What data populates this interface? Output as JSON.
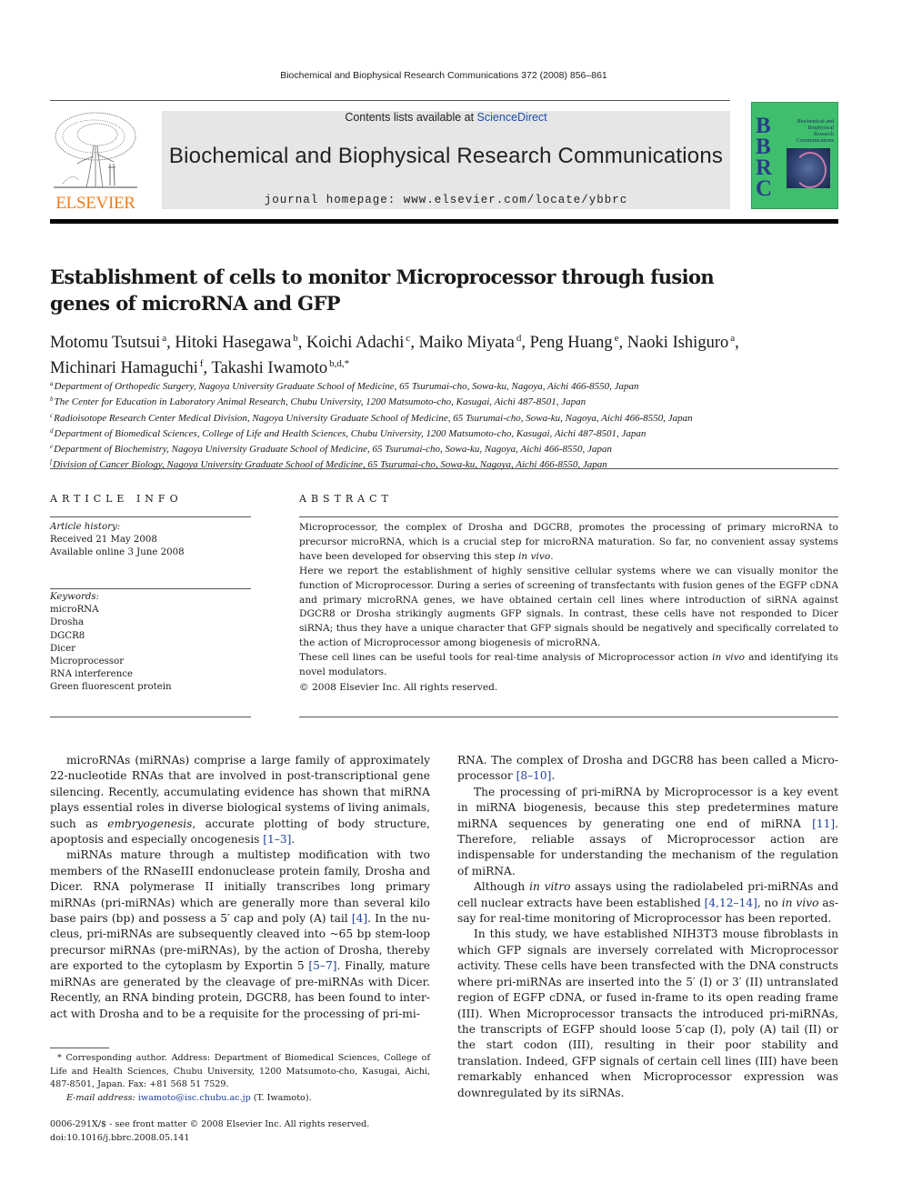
{
  "running_head": "Biochemical and Biophysical Research Communications 372 (2008) 856–861",
  "banner": {
    "contents_prefix": "Contents lists available at ",
    "contents_link": "ScienceDirect",
    "journal_title": "Biochemical and Biophysical Research Communications",
    "homepage": "journal homepage: www.elsevier.com/locate/ybbrc"
  },
  "logo": {
    "publisher": "ELSEVIER"
  },
  "cover": {
    "letters": [
      "B",
      "B",
      "R",
      "C"
    ],
    "title_lines": [
      "Biochemical and",
      "Biophysical",
      "Research",
      "Communications"
    ],
    "colors": {
      "background": "#3fbf6e",
      "letters": "#2b3a8c"
    }
  },
  "article": {
    "title": "Establishment of cells to monitor Microprocessor through fusion genes of microRNA and GFP",
    "authors": [
      {
        "name": "Motomu Tsutsui",
        "sup": "a"
      },
      {
        "name": "Hitoki Hasegawa",
        "sup": "b"
      },
      {
        "name": "Koichi Adachi",
        "sup": "c"
      },
      {
        "name": "Maiko Miyata",
        "sup": "d"
      },
      {
        "name": "Peng Huang",
        "sup": "e"
      },
      {
        "name": "Naoki Ishiguro",
        "sup": "a"
      },
      {
        "name": "Michinari Hamaguchi",
        "sup": "f"
      },
      {
        "name": "Takashi Iwamoto",
        "sup": "b,d,*"
      }
    ],
    "affiliations": [
      {
        "sup": "a",
        "text": "Department of Orthopedic Surgery, Nagoya University Graduate School of Medicine, 65 Tsurumai-cho, Sowa-ku, Nagoya, Aichi 466-8550, Japan"
      },
      {
        "sup": "b",
        "text": "The Center for Education in Laboratory Animal Research, Chubu University, 1200 Matsumoto-cho, Kasugai, Aichi 487-8501, Japan"
      },
      {
        "sup": "c",
        "text": "Radioisotope Research Center Medical Division, Nagoya University Graduate School of Medicine, 65 Tsurumai-cho, Sowa-ku, Nagoya, Aichi 466-8550, Japan"
      },
      {
        "sup": "d",
        "text": "Department of Biomedical Sciences, College of Life and Health Sciences, Chubu University, 1200 Matsumoto-cho, Kasugai, Aichi 487-8501, Japan"
      },
      {
        "sup": "e",
        "text": "Department of Biochemistry, Nagoya University Graduate School of Medicine, 65 Tsurumai-cho, Sowa-ku, Nagoya, Aichi 466-8550, Japan"
      },
      {
        "sup": "f",
        "text": "Division of Cancer Biology, Nagoya University Graduate School of Medicine, 65 Tsurumai-cho, Sowa-ku, Nagoya, Aichi 466-8550, Japan"
      }
    ]
  },
  "article_info": {
    "heading": "ARTICLE INFO",
    "history_label": "Article history:",
    "received": "Received 21 May 2008",
    "available": "Available online 3 June 2008",
    "keywords_label": "Keywords:",
    "keywords": [
      "microRNA",
      "Drosha",
      "DGCR8",
      "Dicer",
      "Microprocessor",
      "RNA interference",
      "Green fluorescent protein"
    ]
  },
  "abstract": {
    "heading": "ABSTRACT",
    "p1a": "Microprocessor, the complex of Drosha and DGCR8, promotes the processing of primary microRNA to precursor microRNA, which is a crucial step for microRNA maturation. So far, no convenient assay systems have been developed for observing this step ",
    "p1_it": "in vivo",
    "p1b": ".",
    "p2": "Here we report the establishment of highly sensitive cellular systems where we can visually monitor the function of Microprocessor. During a series of screening of transfectants with fusion genes of the EGFP cDNA and primary microRNA genes, we have obtained certain cell lines where introduction of siRNA against DGCR8 or Drosha strikingly augments GFP signals. In contrast, these cells have not responded to Dicer siRNA; thus they have a unique character that GFP signals should be negatively and specifically correlated to the action of Microprocessor among biogenesis of microRNA.",
    "p3a": "These cell lines can be useful tools for real-time analysis of Microprocessor action ",
    "p3_it": "in vivo",
    "p3b": " and identifying its novel modulators.",
    "copyright": "© 2008 Elsevier Inc. All rights reserved."
  },
  "body": {
    "col1": {
      "p1a": "microRNAs (miRNAs) comprise a large family of approximately 22-nucleotide RNAs that are involved in post-transcriptional gene silencing. Recently, accumulating evidence has shown that miRNA plays essential roles in diverse biological systems of living animals, such as ",
      "p1_it": "embryogenesis",
      "p1b": ", accurate plotting of body structure, apopto­sis and especially oncogenesis ",
      "p1_ref": "[1–3]",
      "p1c": ".",
      "p2a": "miRNAs mature through a multistep modification with two members of the RNaseIII endonuclease protein family, Drosha and Dicer. RNA polymerase II initially transcribes long primary miRNAs (pri-miRNAs) which are generally more than several kilo base pairs (bp) and possess a 5′ cap and poly (A) tail ",
      "p2_ref1": "[4]",
      "p2b": ". In the nu­cleus, pri-miRNAs are subsequently cleaved into ~65 bp stem-loop precursor miRNAs (pre-miRNAs), by the action of Drosha, thereby are exported to the cytoplasm by Exportin 5 ",
      "p2_ref2": "[5–7]",
      "p2c": ". Finally, mature miRNAs are generated by the cleavage of pre-miRNAs with Dicer. Recently, an RNA binding protein, DGCR8, has been found to inter­act with Drosha and to be a requisite for the processing of pri-mi-"
    },
    "col2": {
      "p0a": "RNA. The complex of Drosha and DGCR8 has been called a Micro­processor ",
      "p0_ref": "[8–10]",
      "p0b": ".",
      "p1a": "The processing of pri-miRNA by Microprocessor is a key event in miRNA biogenesis, because this step predetermines mature miRNA sequences by generating one end of miRNA ",
      "p1_ref": "[11]",
      "p1b": ". Therefore, reliable assays of Microprocessor action are indispensable for understanding the mechanism of the regula­tion of miRNA.",
      "p2a": "Although ",
      "p2_it1": "in vitro",
      "p2b": " assays using the radiolabeled pri-miRNAs and cell nuclear extracts have been established ",
      "p2_ref": "[4,12–14]",
      "p2c": ", no ",
      "p2_it2": "in vivo",
      "p2d": " as­say for real-time monitoring of Microprocessor has been reported.",
      "p3": "In this study, we have established NIH3T3 mouse fibroblasts in which GFP signals are inversely correlated with Microprocessor activity. These cells have been transfected with the DNA constructs where pri-miRNAs are inserted into the 5′ (I) or 3′ (II) untranslated region of EGFP cDNA, or fused in-frame to its open reading frame (III). When Microprocessor transacts the introduced pri-miRNAs, the transcripts of EGFP should loose 5′cap (I), poly (A) tail (II) or the start codon (III), resulting in their poor stability and translation. Indeed, GFP signals of certain cell lines (III) have been remarkably enhanced when Microprocessor expression was downregulated by its siRNAs."
    }
  },
  "footnote": {
    "corresponding": "* Corresponding author. Address: Department of Biomedical Sciences, College of Life and Health Sciences, Chubu University, 1200 Matsumoto-cho, Kasugai, Aichi, 487-8501, Japan. Fax: +81 568 51 7529.",
    "email_label": "E-mail address:",
    "email": "iwamoto@isc.chubu.ac.jp",
    "email_suffix": " (T. Iwamoto)."
  },
  "front_matter": {
    "line1": "0006-291X/$ - see front matter © 2008 Elsevier Inc. All rights reserved.",
    "doi": "doi:10.1016/j.bbrc.2008.05.141"
  }
}
